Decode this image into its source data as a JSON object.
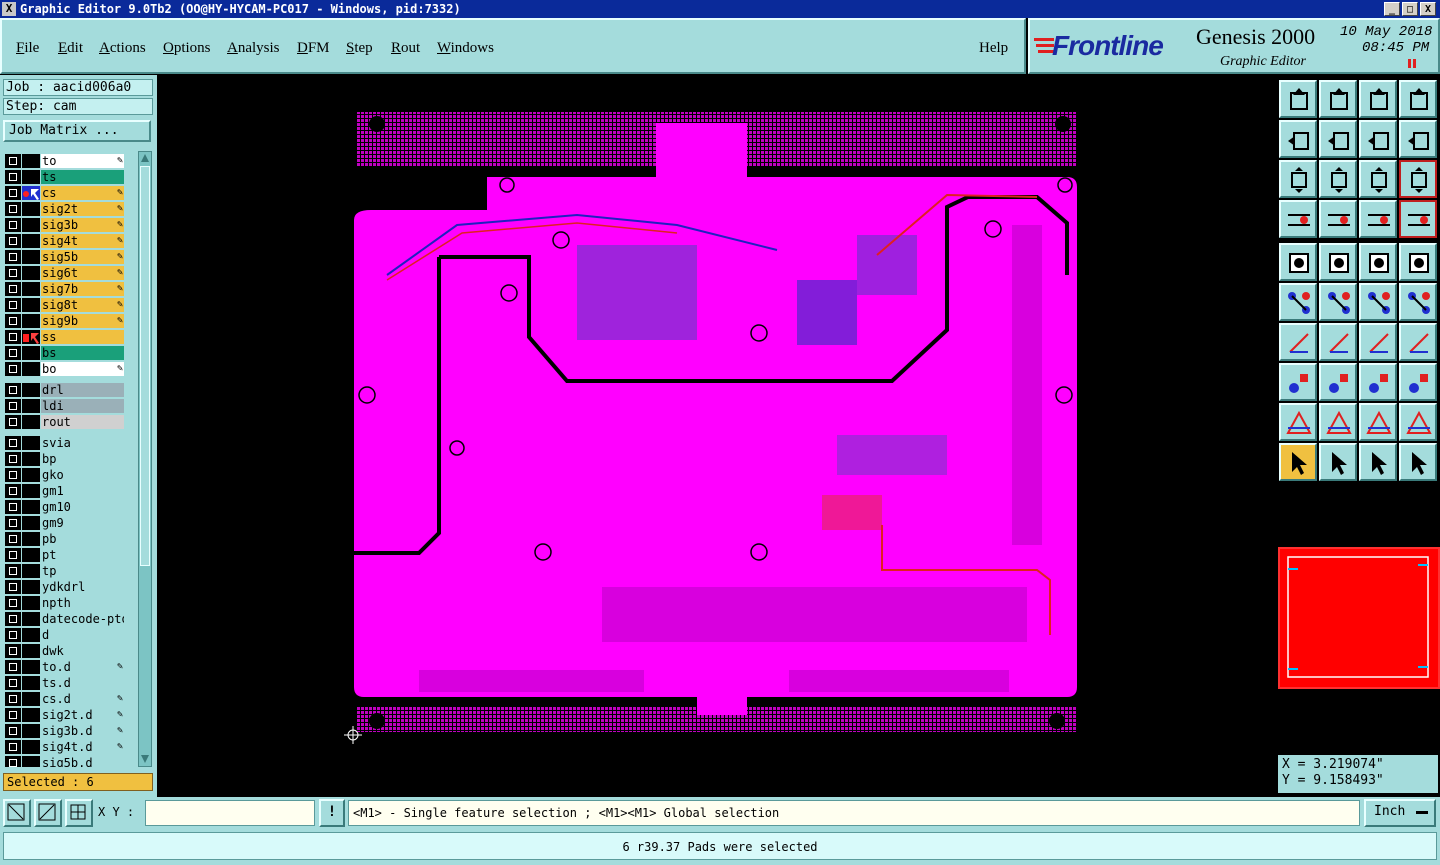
{
  "window": {
    "title": "Graphic Editor 9.0Tb2  (OO@HY-HYCAM-PC017 - Windows, pid:7332)",
    "controls": [
      "_",
      "□",
      "X"
    ]
  },
  "menu": {
    "items": [
      {
        "first": "F",
        "rest": "ile"
      },
      {
        "first": "E",
        "rest": "dit"
      },
      {
        "first": "A",
        "rest": "ctions"
      },
      {
        "first": "O",
        "rest": "ptions"
      },
      {
        "first": "A",
        "rest": "nalysis"
      },
      {
        "first": "D",
        "rest": "FM"
      },
      {
        "first": "S",
        "rest": "tep"
      },
      {
        "first": "R",
        "rest": "out"
      },
      {
        "first": "W",
        "rest": "indows"
      }
    ],
    "help": "Help"
  },
  "brand": {
    "logo": "Frontline",
    "product": "Genesis 2000",
    "subtitle": "Graphic Editor",
    "date": "10 May 2018",
    "time": "08:45 PM"
  },
  "job": {
    "job_label": "Job : aacid006a0",
    "step_label": "Step: cam",
    "matrix_button": "Job Matrix ..."
  },
  "layers": [
    {
      "name": "to",
      "bg": "#ffffff",
      "pen": true,
      "mark": ""
    },
    {
      "name": "ts",
      "bg": "#1aa07a",
      "pen": false,
      "mark": ""
    },
    {
      "name": "cs",
      "bg": "#f0c040",
      "pen": true,
      "mark": "work"
    },
    {
      "name": "sig2t",
      "bg": "#f0c040",
      "pen": true,
      "mark": ""
    },
    {
      "name": "sig3b",
      "bg": "#f0c040",
      "pen": true,
      "mark": ""
    },
    {
      "name": "sig4t",
      "bg": "#f0c040",
      "pen": true,
      "mark": ""
    },
    {
      "name": "sig5b",
      "bg": "#f0c040",
      "pen": true,
      "mark": ""
    },
    {
      "name": "sig6t",
      "bg": "#f0c040",
      "pen": true,
      "mark": ""
    },
    {
      "name": "sig7b",
      "bg": "#f0c040",
      "pen": true,
      "mark": ""
    },
    {
      "name": "sig8t",
      "bg": "#f0c040",
      "pen": true,
      "mark": ""
    },
    {
      "name": "sig9b",
      "bg": "#f0c040",
      "pen": true,
      "mark": ""
    },
    {
      "name": "ss",
      "bg": "#f0c040",
      "pen": false,
      "mark": "display"
    },
    {
      "name": "bs",
      "bg": "#1aa07a",
      "pen": false,
      "mark": ""
    },
    {
      "name": "bo",
      "bg": "#ffffff",
      "pen": true,
      "mark": ""
    },
    {
      "name": "drl",
      "bg": "#9ab0b8",
      "pen": false,
      "mark": "",
      "gap": true
    },
    {
      "name": "ldi",
      "bg": "#9ab0b8",
      "pen": false,
      "mark": ""
    },
    {
      "name": "rout",
      "bg": "#d0d0d0",
      "pen": false,
      "mark": ""
    },
    {
      "name": "svia",
      "bg": "#a4dcdc",
      "pen": false,
      "mark": "",
      "gap": true
    },
    {
      "name": "bp",
      "bg": "#a4dcdc",
      "pen": false,
      "mark": ""
    },
    {
      "name": "gko",
      "bg": "#a4dcdc",
      "pen": false,
      "mark": ""
    },
    {
      "name": "gm1",
      "bg": "#a4dcdc",
      "pen": false,
      "mark": ""
    },
    {
      "name": "gm10",
      "bg": "#a4dcdc",
      "pen": false,
      "mark": ""
    },
    {
      "name": "gm9",
      "bg": "#a4dcdc",
      "pen": false,
      "mark": ""
    },
    {
      "name": "pb",
      "bg": "#a4dcdc",
      "pen": false,
      "mark": ""
    },
    {
      "name": "pt",
      "bg": "#a4dcdc",
      "pen": false,
      "mark": ""
    },
    {
      "name": "tp",
      "bg": "#a4dcdc",
      "pen": false,
      "mark": ""
    },
    {
      "name": "ydkdrl",
      "bg": "#a4dcdc",
      "pen": false,
      "mark": ""
    },
    {
      "name": "npth",
      "bg": "#a4dcdc",
      "pen": false,
      "mark": ""
    },
    {
      "name": "datecode-pto",
      "bg": "#a4dcdc",
      "pen": false,
      "mark": ""
    },
    {
      "name": "d",
      "bg": "#a4dcdc",
      "pen": false,
      "mark": ""
    },
    {
      "name": "dwk",
      "bg": "#a4dcdc",
      "pen": false,
      "mark": ""
    },
    {
      "name": "to.d",
      "bg": "#a4dcdc",
      "pen": true,
      "mark": ""
    },
    {
      "name": "ts.d",
      "bg": "#a4dcdc",
      "pen": false,
      "mark": ""
    },
    {
      "name": "cs.d",
      "bg": "#a4dcdc",
      "pen": true,
      "mark": ""
    },
    {
      "name": "sig2t.d",
      "bg": "#a4dcdc",
      "pen": true,
      "mark": ""
    },
    {
      "name": "sig3b.d",
      "bg": "#a4dcdc",
      "pen": true,
      "mark": ""
    },
    {
      "name": "sig4t.d",
      "bg": "#a4dcdc",
      "pen": true,
      "mark": ""
    },
    {
      "name": "sig5b.d",
      "bg": "#a4dcdc",
      "pen": false,
      "mark": ""
    }
  ],
  "selected_count": "Selected : 6",
  "coords": {
    "x": "X = 3.219074\"",
    "y": "Y = 9.158493\""
  },
  "input": {
    "xy_label": "X Y :",
    "xy_value": "",
    "hint": "<M1> - Single feature selection ; <M1><M1> Global selection",
    "unit": "Inch"
  },
  "toolbox_icons": [
    "snap-icon",
    "window-icon",
    "home-icon",
    "split-view-icon",
    "pan-left-icon",
    "pan-right-icon",
    "mirror-icon",
    "flip-s-icon",
    "zoom-fit-icon",
    "zoom-home-icon",
    "zoom-1to2-icon",
    "query-icon",
    "measure-icon",
    "grid-icon",
    "layer-stack-icon",
    "layer-stack-red-icon",
    "select-pad-icon",
    "draw-rect-icon",
    "ruler-icon",
    "circle-select-icon",
    "connect-icon",
    "cross-icon",
    "node-add-icon",
    "node-move-icon",
    "angle-icon",
    "line-icon",
    "arc-icon",
    "flow-icon",
    "pad-add-icon",
    "edge-icon",
    "snap-box-icon",
    "shapes-icon",
    "tri-a-icon",
    "tri-b-icon",
    "tri-c-icon",
    "tri-d-icon",
    "pointer-icon",
    "pointer-box-icon",
    "pointer-select-icon",
    "pointer-net-icon"
  ],
  "status_message": "6 r39.37 Pads were selected",
  "colors": {
    "panel": "#a4dcdc",
    "board": "#ff00ff",
    "selected_bg": "#f0c040",
    "title_bg": "#0a2a9a"
  }
}
